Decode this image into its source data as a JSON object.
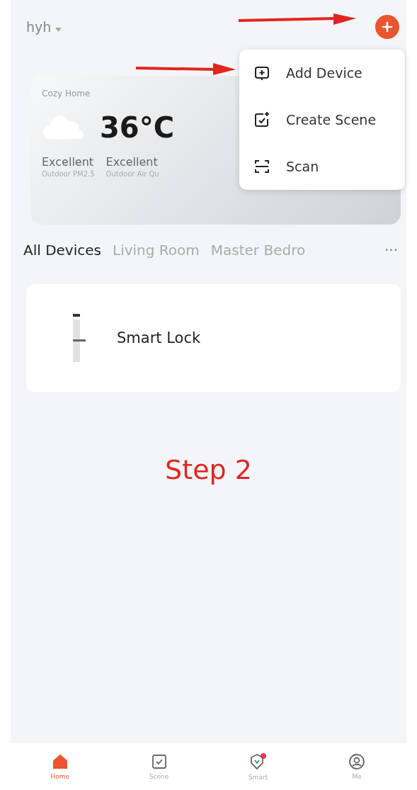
{
  "header": {
    "home_name": "hyh"
  },
  "weather": {
    "home_label": "Cozy Home",
    "temperature": "36°C",
    "stats": [
      {
        "value": "Excellent",
        "label": "Outdoor PM2.5"
      },
      {
        "value": "Excellent",
        "label": "Outdoor Air Qu"
      }
    ]
  },
  "menu": [
    {
      "kind": "add",
      "label": "Add Device"
    },
    {
      "kind": "scene",
      "label": "Create Scene"
    },
    {
      "kind": "scan",
      "label": "Scan"
    }
  ],
  "tabs": [
    {
      "label": "All Devices",
      "selected": true
    },
    {
      "label": "Living Room",
      "selected": false
    },
    {
      "label": "Master Bedro",
      "selected": false
    }
  ],
  "tabs_more": "···",
  "devices": [
    {
      "name": "Smart Lock"
    }
  ],
  "annotation": "Step 2",
  "nav": [
    {
      "kind": "home",
      "label": "Home",
      "selected": true
    },
    {
      "kind": "scene",
      "label": "Scene",
      "selected": false
    },
    {
      "kind": "smart",
      "label": "Smart",
      "selected": false
    },
    {
      "kind": "me",
      "label": "Me",
      "selected": false
    }
  ]
}
